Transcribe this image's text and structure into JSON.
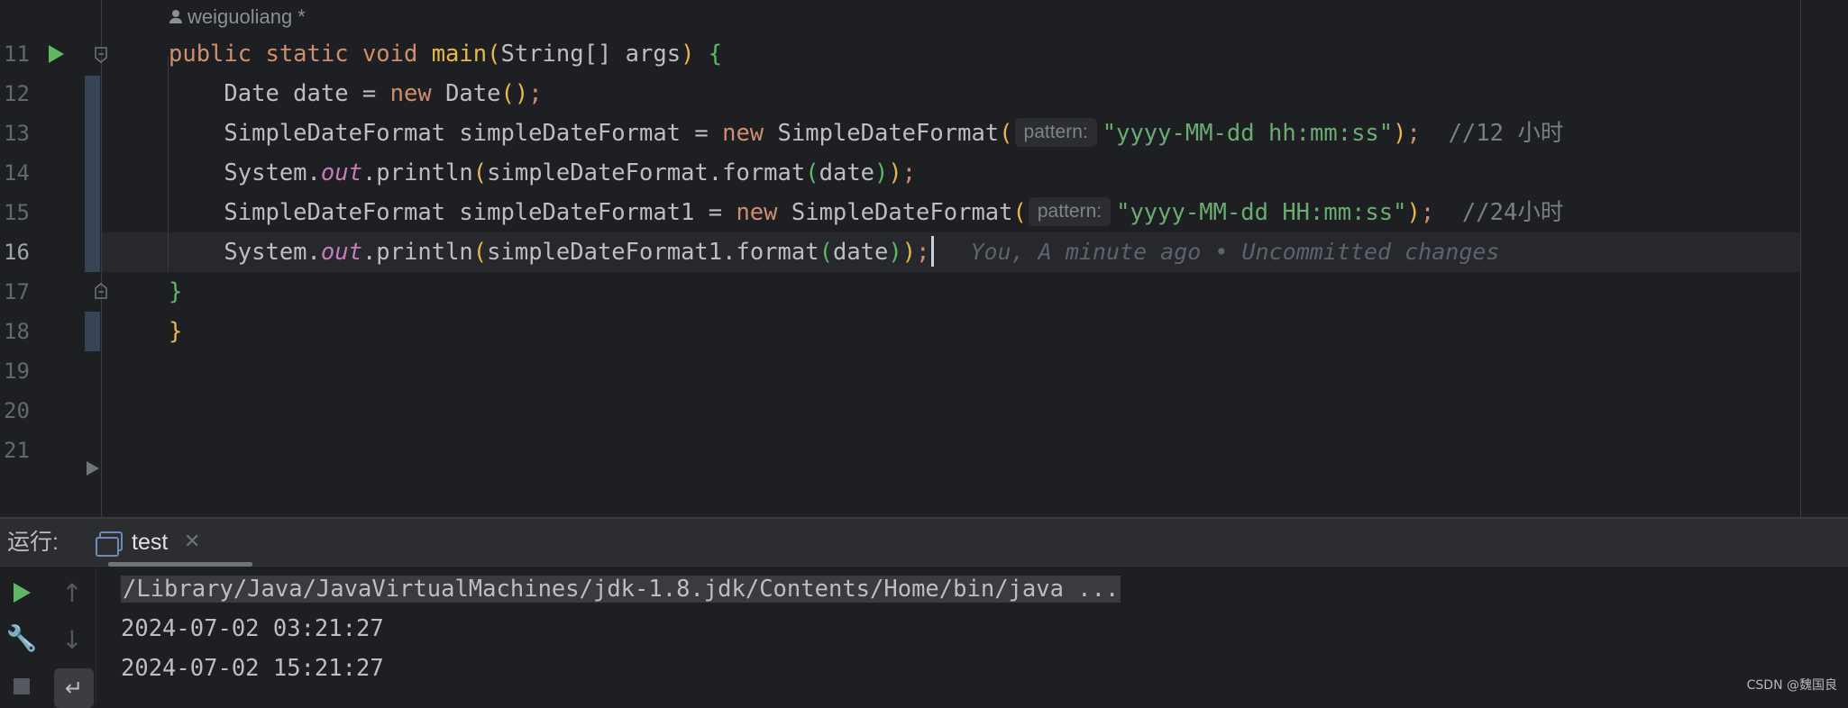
{
  "editor": {
    "author_hint": "weiguoliang *",
    "line_numbers": [
      "11",
      "12",
      "13",
      "14",
      "15",
      "16",
      "17",
      "18",
      "19",
      "20",
      "21"
    ],
    "current_line": "16",
    "lines": [
      {
        "tokens": [
          {
            "t": "public ",
            "c": "kw"
          },
          {
            "t": "static ",
            "c": "kw"
          },
          {
            "t": "void ",
            "c": "kw"
          },
          {
            "t": "main",
            "c": "mn"
          },
          {
            "t": "(",
            "c": "br1"
          },
          {
            "t": "String[] args"
          },
          {
            "t": ")",
            "c": "br1"
          },
          {
            "t": " "
          },
          {
            "t": "{",
            "c": "br2"
          }
        ]
      },
      {
        "tokens": [
          {
            "t": "    Date date = "
          },
          {
            "t": "new ",
            "c": "kw"
          },
          {
            "t": "Date"
          },
          {
            "t": "()",
            "c": "br1"
          },
          {
            "t": ";",
            "c": "kw"
          }
        ]
      },
      {
        "tokens": [
          {
            "t": "    SimpleDateFormat simpleDateFormat = "
          },
          {
            "t": "new ",
            "c": "kw"
          },
          {
            "t": "SimpleDateFormat"
          },
          {
            "t": "(",
            "c": "br1"
          },
          {
            "hint": "pattern:"
          },
          {
            "t": "\"yyyy-MM-dd hh:mm:ss\"",
            "c": "str"
          },
          {
            "t": ")",
            "c": "br1"
          },
          {
            "t": ";",
            "c": "kw"
          },
          {
            "t": "  //12 小时",
            "c": "cmt"
          }
        ]
      },
      {
        "tokens": [
          {
            "t": "    System."
          },
          {
            "t": "out",
            "c": "fld"
          },
          {
            "t": ".println"
          },
          {
            "t": "(",
            "c": "br1"
          },
          {
            "t": "simpleDateFormat.format"
          },
          {
            "t": "(",
            "c": "br2"
          },
          {
            "t": "date"
          },
          {
            "t": ")",
            "c": "br2"
          },
          {
            "t": ")",
            "c": "br1"
          },
          {
            "t": ";",
            "c": "kw"
          }
        ]
      },
      {
        "tokens": [
          {
            "t": "    SimpleDateFormat simpleDateFormat1 = "
          },
          {
            "t": "new ",
            "c": "kw"
          },
          {
            "t": "SimpleDateFormat"
          },
          {
            "t": "(",
            "c": "br1"
          },
          {
            "hint": "pattern:"
          },
          {
            "t": "\"yyyy-MM-dd HH:mm:ss\"",
            "c": "str"
          },
          {
            "t": ")",
            "c": "br1"
          },
          {
            "t": ";",
            "c": "kw"
          },
          {
            "t": "  //24小时",
            "c": "cmt"
          }
        ]
      },
      {
        "tokens": [
          {
            "t": "    System."
          },
          {
            "t": "out",
            "c": "fld"
          },
          {
            "t": ".println"
          },
          {
            "t": "(",
            "c": "br1"
          },
          {
            "t": "simpleDateFormat1.format"
          },
          {
            "t": "(",
            "c": "br2"
          },
          {
            "t": "date"
          },
          {
            "t": ")",
            "c": "br2"
          },
          {
            "t": ")",
            "c": "br1"
          },
          {
            "t": ";",
            "c": "kw"
          },
          {
            "caret": true
          },
          {
            "blame": "You, A minute ago • Uncommitted changes"
          }
        ]
      },
      {
        "tokens": [
          {
            "t": "}",
            "c": "br2"
          }
        ]
      },
      {
        "tokens": [
          {
            "t": "}",
            "c": "br1"
          }
        ]
      }
    ]
  },
  "run_panel": {
    "title": "运行:",
    "tab_label": "test",
    "tab_close": "✕",
    "console": [
      "/Library/Java/JavaVirtualMachines/jdk-1.8.jdk/Contents/Home/bin/java ...",
      "2024-07-02 03:21:27",
      "2024-07-02 15:21:27"
    ]
  },
  "icons": {
    "run_gutter": "run-gutter-icon",
    "fold": "fold-icon",
    "rerun": "play-icon",
    "up": "arrow-up-icon",
    "down": "arrow-down-icon",
    "settings": "wrench-icon",
    "soft_wrap": "soft-wrap-icon",
    "stop": "stop-icon"
  },
  "colors": {
    "keyword": "#cf8e6d",
    "method": "#e8b84a",
    "string": "#6aab73",
    "comment": "#7a7e85",
    "static_field": "#c77dbb",
    "run_green": "#5fb865"
  },
  "watermark": "CSDN @魏国良"
}
